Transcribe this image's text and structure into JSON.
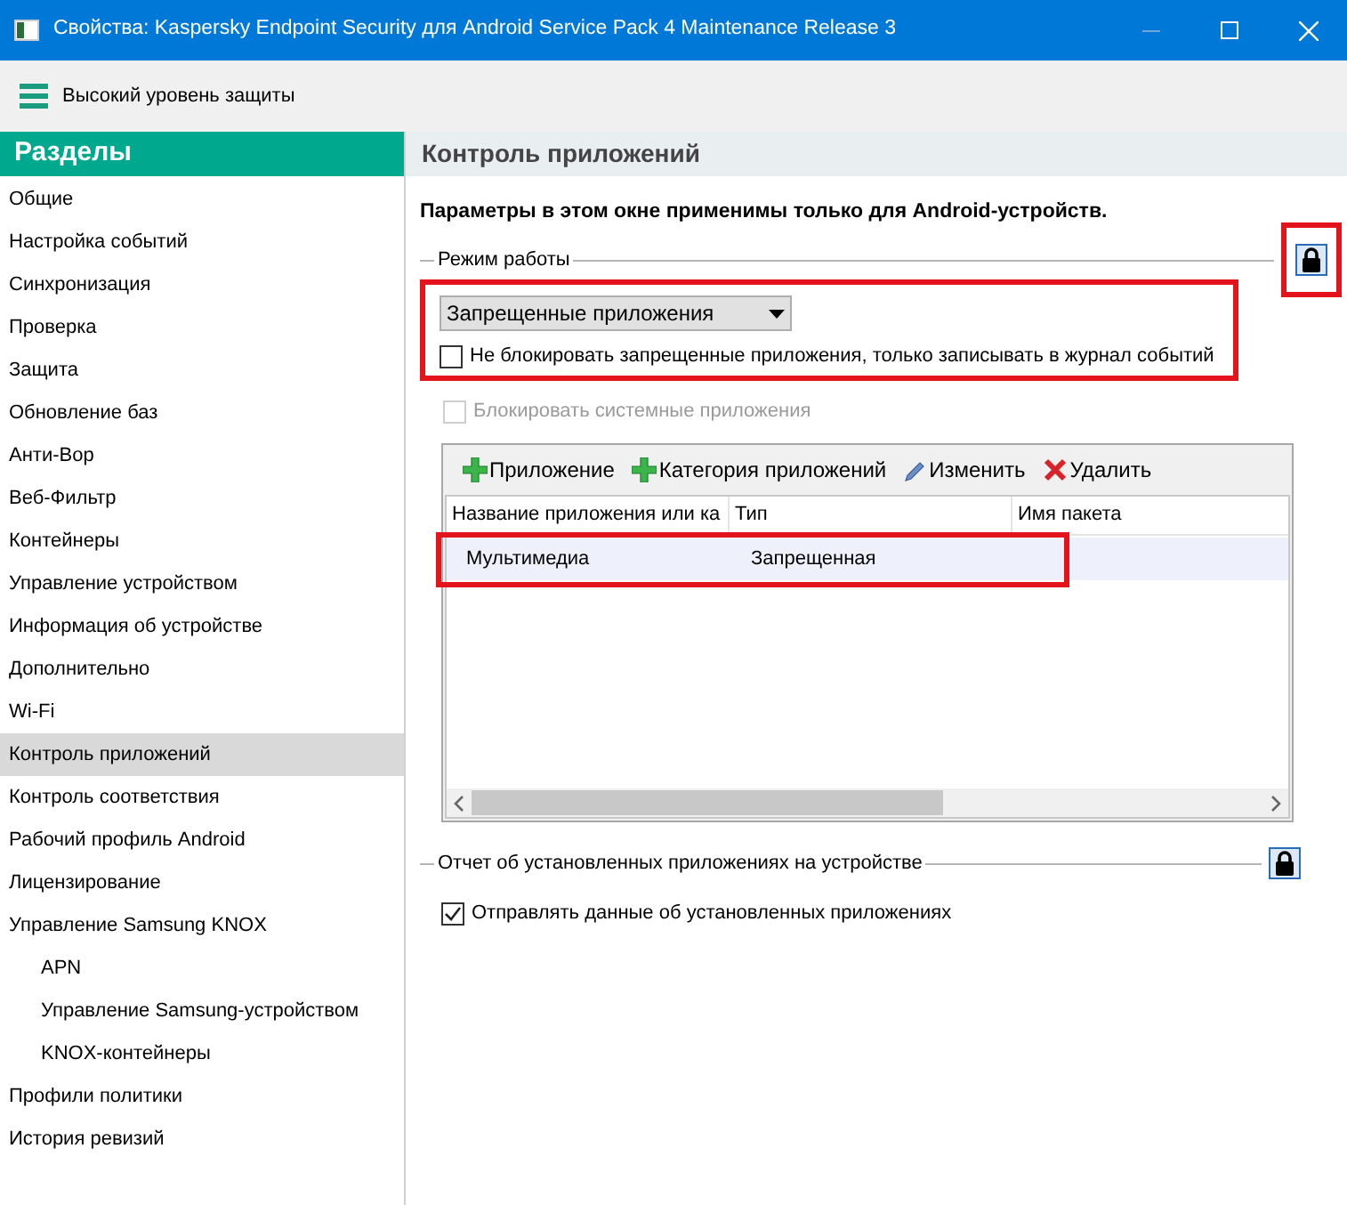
{
  "window": {
    "title": "Свойства: Kaspersky Endpoint Security для Android Service Pack 4 Maintenance Release 3"
  },
  "toolbar": {
    "label": "Высокий уровень защиты"
  },
  "sidebar": {
    "title": "Разделы",
    "items": [
      {
        "label": "Общие",
        "selected": false
      },
      {
        "label": "Настройка событий",
        "selected": false
      },
      {
        "label": "Синхронизация",
        "selected": false
      },
      {
        "label": "Проверка",
        "selected": false
      },
      {
        "label": "Защита",
        "selected": false
      },
      {
        "label": "Обновление баз",
        "selected": false
      },
      {
        "label": "Анти-Вор",
        "selected": false
      },
      {
        "label": "Веб-Фильтр",
        "selected": false
      },
      {
        "label": "Контейнеры",
        "selected": false
      },
      {
        "label": "Управление устройством",
        "selected": false
      },
      {
        "label": "Информация об устройстве",
        "selected": false
      },
      {
        "label": "Дополнительно",
        "selected": false
      },
      {
        "label": "Wi-Fi",
        "selected": false
      },
      {
        "label": "Контроль приложений",
        "selected": true
      },
      {
        "label": "Контроль соответствия",
        "selected": false
      },
      {
        "label": "Рабочий профиль Android",
        "selected": false
      },
      {
        "label": "Лицензирование",
        "selected": false
      },
      {
        "label": "Управление Samsung KNOX",
        "selected": false,
        "children": [
          {
            "label": "APN",
            "selected": false
          },
          {
            "label": "Управление Samsung-устройством",
            "selected": false
          },
          {
            "label": "KNOX-контейнеры",
            "selected": false
          }
        ]
      },
      {
        "label": "Профили политики",
        "selected": false
      },
      {
        "label": "История ревизий",
        "selected": false
      }
    ]
  },
  "panel": {
    "title": "Контроль приложений",
    "note": "Параметры в этом окне применимы только для Android-устройств.",
    "mode_group": {
      "title": "Режим работы",
      "locked": true,
      "dropdown": {
        "value": "Запрещенные приложения"
      },
      "checkboxes": [
        {
          "label": "Не блокировать запрещенные приложения, только записывать в журнал событий",
          "checked": false,
          "disabled": false
        },
        {
          "label": "Блокировать системные приложения",
          "checked": false,
          "disabled": true
        }
      ]
    },
    "table": {
      "actions": [
        {
          "label": "Приложение",
          "kind": "add"
        },
        {
          "label": "Категория приложений",
          "kind": "add"
        },
        {
          "label": "Изменить",
          "kind": "edit"
        },
        {
          "label": "Удалить",
          "kind": "delete"
        }
      ],
      "columns": [
        "Название приложения или ка",
        "Тип",
        "Имя пакета"
      ],
      "rows": [
        {
          "cells": [
            "Мультимедиа",
            "Запрещенная",
            ""
          ],
          "selected": true
        }
      ]
    },
    "report_group": {
      "title": "Отчет об установленных приложениях на устройстве",
      "locked": true,
      "checkboxes": [
        {
          "label": "Отправлять данные об установленных приложениях",
          "checked": true,
          "disabled": false
        }
      ]
    }
  }
}
